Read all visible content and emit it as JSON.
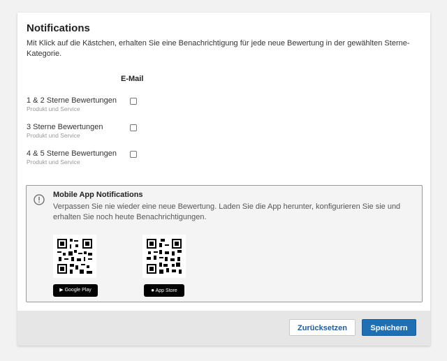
{
  "notifications": {
    "title": "Notifications",
    "description": "Mit Klick auf die Kästchen, erhalten Sie eine Benachrichtigung für jede neue Bewertung in der gewählten Sterne-Kategorie.",
    "column_header": "E-Mail",
    "rows": [
      {
        "label": "1 & 2 Sterne Bewertungen",
        "sub": "Produkt und Service",
        "checked": false
      },
      {
        "label": "3 Sterne Bewertungen",
        "sub": "Produkt und Service",
        "checked": false
      },
      {
        "label": "4 & 5 Sterne Bewertungen",
        "sub": "Produkt und Service",
        "checked": false
      }
    ]
  },
  "mobile": {
    "icon": "exclamation-circle-icon",
    "title": "Mobile App Notifications",
    "text": "Verpassen Sie nie wieder eine neue Bewertung. Laden Sie die App herunter, konfigurieren Sie sie und erhalten Sie noch heute Benachrichtigungen.",
    "google_play_badge": "Google Play",
    "app_store_badge": "App Store"
  },
  "footer": {
    "reset_label": "Zurücksetzen",
    "save_label": "Speichern"
  },
  "colors": {
    "primary": "#1f6fb5",
    "link": "#1a5da6"
  }
}
